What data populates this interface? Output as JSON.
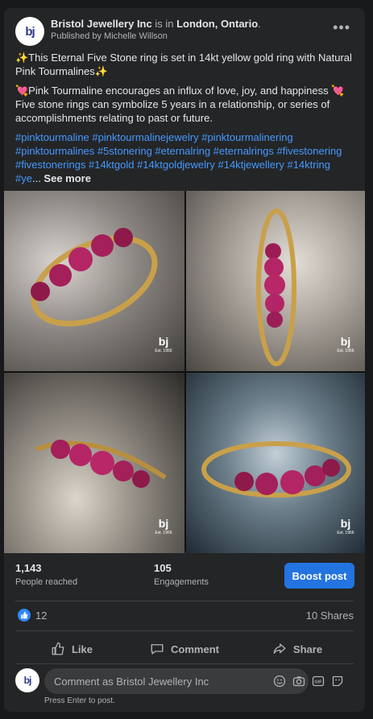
{
  "post": {
    "page_name": "Bristol Jewellery Inc",
    "is_in_text": " is in ",
    "location": "London, Ontario",
    "location_suffix": ".",
    "published_by": "Published by Michelle Willson",
    "avatar_text": "bj",
    "paragraph1": "✨This Eternal Five Stone ring is set in 14kt yellow gold ring with Natural Pink Tourmalines✨",
    "paragraph2": "💘Pink Tourmaline encourages an influx of love, joy, and happiness 💘 Five stone rings can symbolize 5 years in a relationship, or series of accomplishments relating to past or future.",
    "hashtags": "#pinktourmaline #pinktourmalinejewelry #pinktourmalinering #pinktourmalines #5stonering #eternalring #eternalrings #fivestonering #fivestonerings #14ktgold #14ktgoldjewelry #14ktjewellery #14ktring #ye",
    "ellipsis": "...",
    "see_more": " See more",
    "watermark": "bj",
    "watermark_sub": "Est. 1956"
  },
  "stats": {
    "reached_value": "1,143",
    "reached_label": "People reached",
    "engagements_value": "105",
    "engagements_label": "Engagements",
    "boost_label": "Boost post"
  },
  "reactions": {
    "like_count": "12",
    "shares": "10 Shares"
  },
  "actions": {
    "like": "Like",
    "comment": "Comment",
    "share": "Share"
  },
  "comment_box": {
    "placeholder": "Comment as Bristol Jewellery Inc",
    "hint": "Press Enter to post."
  },
  "colors": {
    "accent": "#2374e1",
    "hashtag": "#4599ff",
    "card_bg": "#242526",
    "page_bg": "#18191a"
  },
  "icons": [
    "more-icon",
    "like-icon",
    "comment-icon",
    "share-icon",
    "emoji-icon",
    "camera-icon",
    "gif-icon",
    "sticker-icon"
  ]
}
